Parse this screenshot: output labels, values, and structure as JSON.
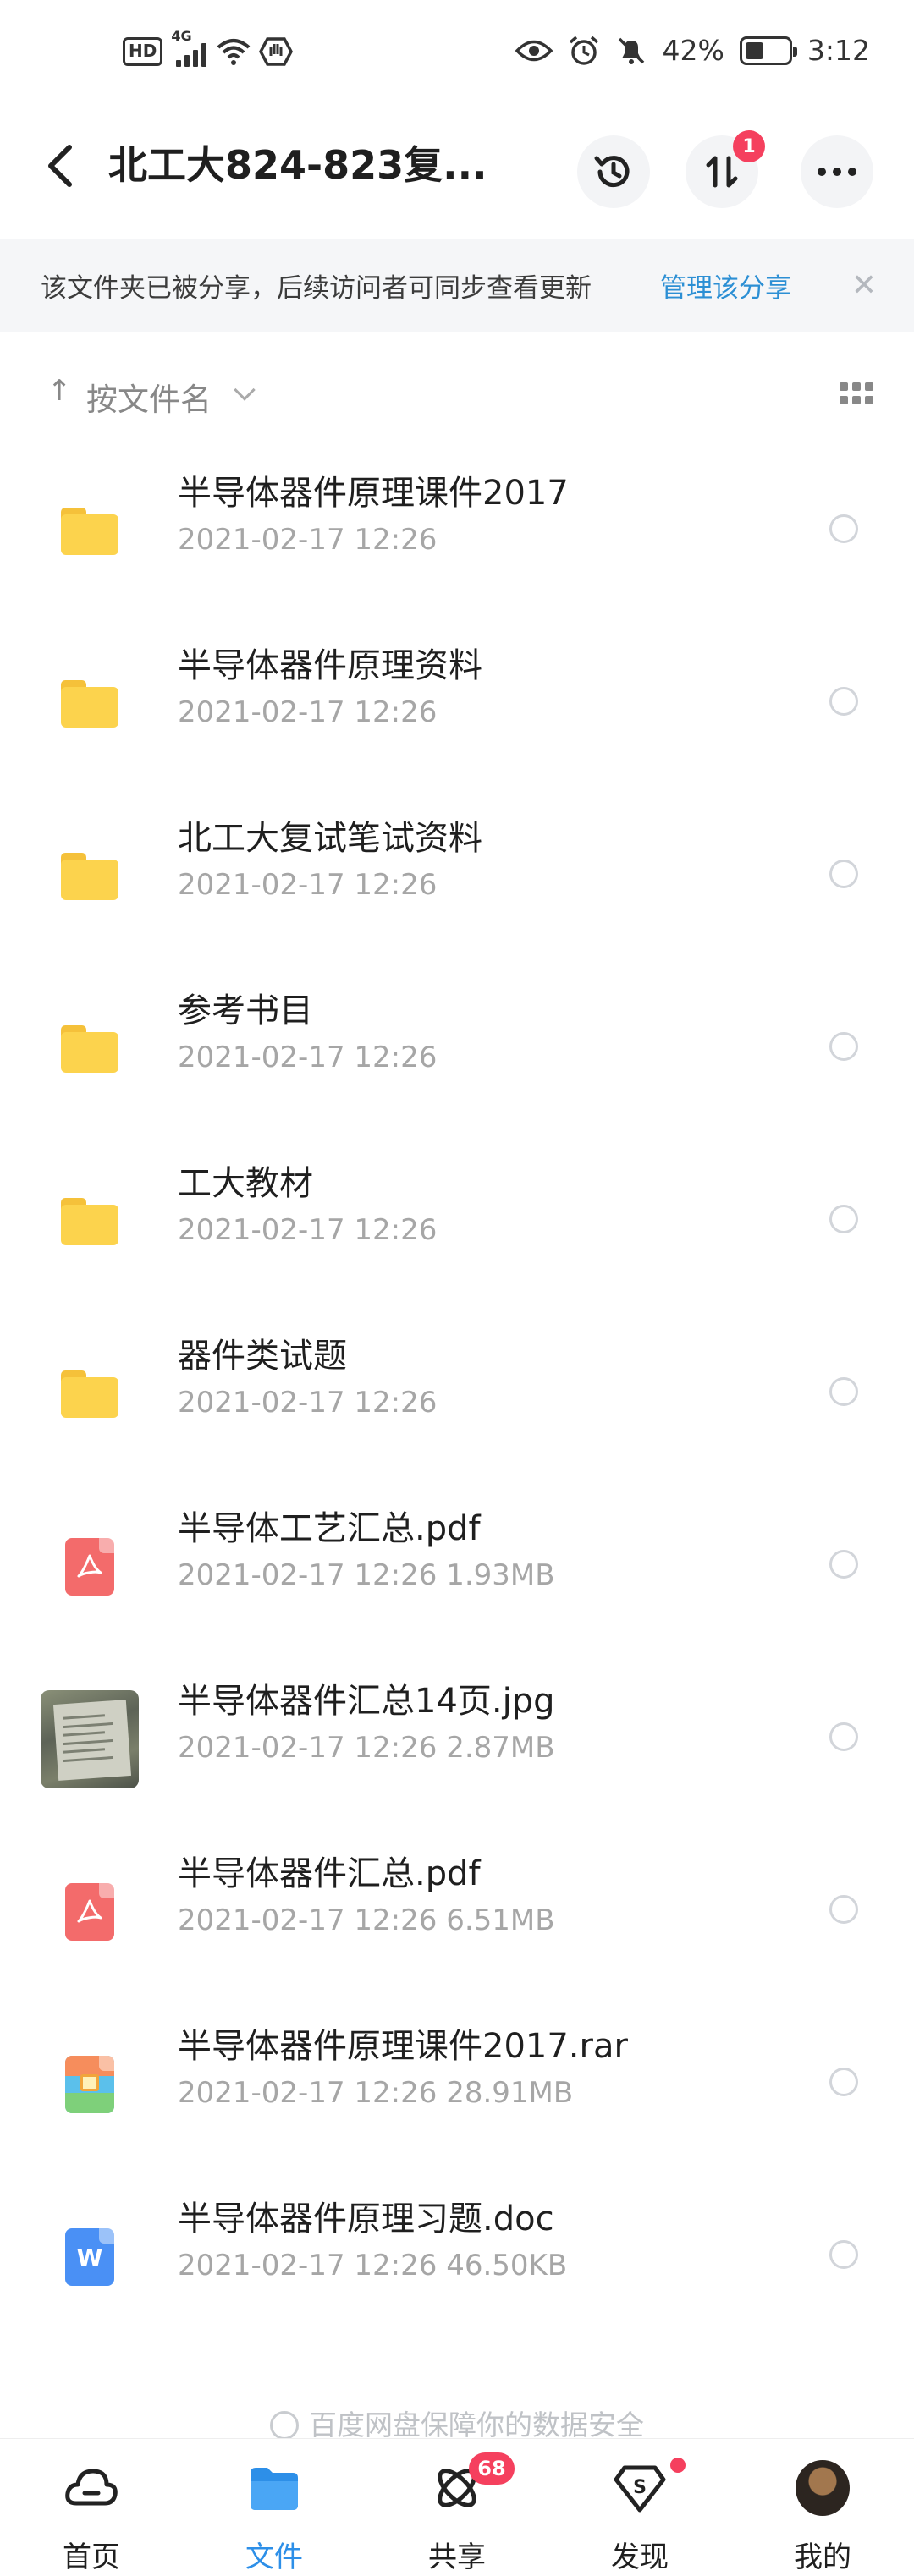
{
  "status_bar": {
    "hd": "HD",
    "network": "4G",
    "battery_percent": "42%",
    "battery_level": 0.42,
    "time": "3:12"
  },
  "header": {
    "title": "北工大824-823复...",
    "transfer_badge": "1"
  },
  "notice": {
    "text": "该文件夹已被分享，后续访问者可同步查看更新",
    "link": "管理该分享",
    "close": "✕"
  },
  "sortbar": {
    "arrow": "↑",
    "label": "按文件名"
  },
  "files": [
    {
      "name": "半导体器件原理课件2017",
      "meta": "2021-02-17  12:26",
      "type": "folder"
    },
    {
      "name": "半导体器件原理资料",
      "meta": "2021-02-17  12:26",
      "type": "folder"
    },
    {
      "name": "北工大复试笔试资料",
      "meta": "2021-02-17  12:26",
      "type": "folder"
    },
    {
      "name": "参考书目",
      "meta": "2021-02-17  12:26",
      "type": "folder"
    },
    {
      "name": "工大教材",
      "meta": "2021-02-17  12:26",
      "type": "folder"
    },
    {
      "name": "器件类试题",
      "meta": "2021-02-17  12:26",
      "type": "folder"
    },
    {
      "name": "半导体工艺汇总.pdf",
      "meta": "2021-02-17  12:26  1.93MB",
      "type": "pdf"
    },
    {
      "name": "半导体器件汇总14页.jpg",
      "meta": "2021-02-17  12:26  2.87MB",
      "type": "jpg"
    },
    {
      "name": "半导体器件汇总.pdf",
      "meta": "2021-02-17  12:26  6.51MB",
      "type": "pdf"
    },
    {
      "name": "半导体器件原理课件2017.rar",
      "meta": "2021-02-17  12:26  28.91MB",
      "type": "rar"
    },
    {
      "name": "半导体器件原理习题.doc",
      "meta": "2021-02-17  12:26  46.50KB",
      "type": "doc"
    }
  ],
  "footer_note": "百度网盘保障你的数据安全",
  "bottom_nav": {
    "items": [
      {
        "label": "首页"
      },
      {
        "label": "文件"
      },
      {
        "label": "共享",
        "badge": "68"
      },
      {
        "label": "发现"
      },
      {
        "label": "我的"
      }
    ],
    "active_color": "#2d8fe8"
  },
  "colors": {
    "folder": "#fcd34d",
    "pdf": "#f36b6b",
    "doc": "#4a90f5",
    "link": "#2c8fd4",
    "badge": "#f5405e"
  },
  "icons": {
    "doc_glyph": "W",
    "share_glyph": "S"
  }
}
